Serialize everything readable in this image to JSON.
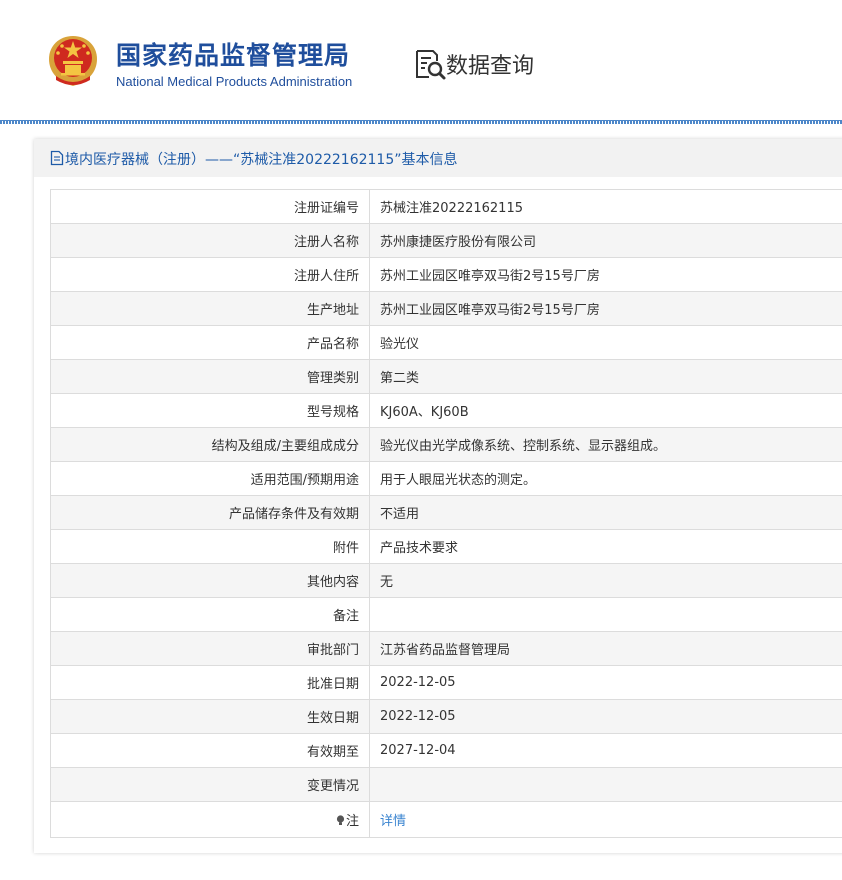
{
  "header": {
    "org_name_cn": "国家药品监督管理局",
    "org_name_en": "National Medical Products Administration",
    "data_query_label": "数据查询",
    "emblem_icon": "national-emblem-icon",
    "query_icon": "document-search-icon",
    "brand_color": "#1f4e9c"
  },
  "card": {
    "title": "境内医疗器械（注册）——“苏械注准20222162115”基本信息",
    "title_icon": "document-icon",
    "title_color": "#1e5ba8"
  },
  "table": {
    "rows": [
      {
        "label": "注册证编号",
        "value": "苏械注准20222162115"
      },
      {
        "label": "注册人名称",
        "value": "苏州康捷医疗股份有限公司"
      },
      {
        "label": "注册人住所",
        "value": "苏州工业园区唯亭双马街2号15号厂房"
      },
      {
        "label": "生产地址",
        "value": "苏州工业园区唯亭双马街2号15号厂房"
      },
      {
        "label": "产品名称",
        "value": "验光仪"
      },
      {
        "label": "管理类别",
        "value": "第二类"
      },
      {
        "label": "型号规格",
        "value": "KJ60A、KJ60B"
      },
      {
        "label": "结构及组成/主要组成成分",
        "value": "验光仪由光学成像系统、控制系统、显示器组成。"
      },
      {
        "label": "适用范围/预期用途",
        "value": "用于人眼屈光状态的测定。"
      },
      {
        "label": "产品储存条件及有效期",
        "value": "不适用"
      },
      {
        "label": "附件",
        "value": "产品技术要求"
      },
      {
        "label": "其他内容",
        "value": "无"
      },
      {
        "label": "备注",
        "value": ""
      },
      {
        "label": "审批部门",
        "value": "江苏省药品监督管理局"
      },
      {
        "label": "批准日期",
        "value": "2022-12-05"
      },
      {
        "label": "生效日期",
        "value": "2022-12-05"
      },
      {
        "label": "有效期至",
        "value": "2027-12-04"
      },
      {
        "label": "变更情况",
        "value": ""
      }
    ],
    "note_row": {
      "label": "注",
      "icon": "lightbulb-icon",
      "link_text": "详情",
      "link_color": "#3a84d0"
    }
  }
}
